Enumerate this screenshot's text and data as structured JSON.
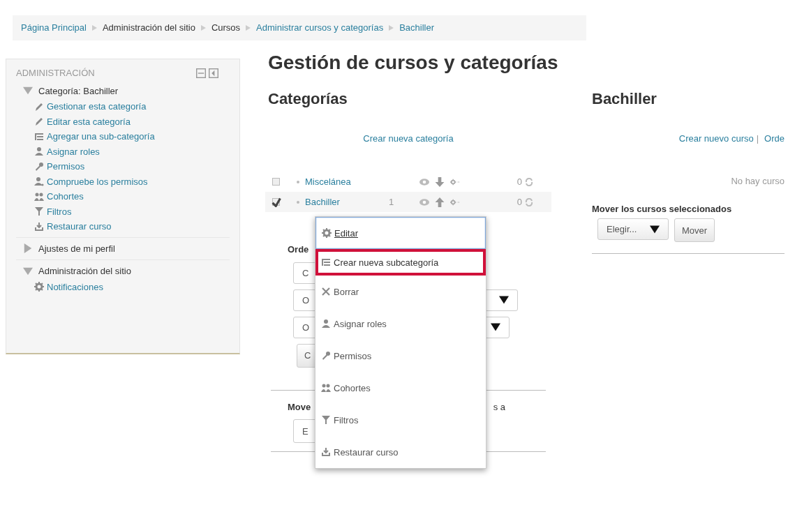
{
  "breadcrumb": [
    {
      "label": "Página Principal",
      "kind": "link"
    },
    {
      "label": "Administración del sitio",
      "kind": "text"
    },
    {
      "label": "Cursos",
      "kind": "text"
    },
    {
      "label": "Administrar cursos y categorías",
      "kind": "link"
    },
    {
      "label": "Bachiller",
      "kind": "link"
    }
  ],
  "sidebar": {
    "title": "ADMINISTRACIÓN",
    "nodes": [
      {
        "label": "Categoría: Bachiller",
        "expanded": true,
        "children": [
          {
            "label": "Gestionar esta categoría"
          },
          {
            "label": "Editar esta categoría"
          },
          {
            "label": "Agregar una sub-categoría"
          },
          {
            "label": "Asignar roles"
          },
          {
            "label": "Permisos"
          },
          {
            "label": "Compruebe los permisos"
          },
          {
            "label": "Cohortes"
          },
          {
            "label": "Filtros"
          },
          {
            "label": "Restaurar curso"
          }
        ]
      },
      {
        "label": "Ajustes de mi perfil",
        "expanded": false
      },
      {
        "label": "Administración del sitio",
        "expanded": true,
        "children": [
          {
            "label": "Notificaciones"
          }
        ]
      }
    ]
  },
  "page_title": "Gestión de cursos y categorías",
  "categories": {
    "title": "Categorías",
    "create_link": "Crear nueva categoría",
    "rows": [
      {
        "name": "Miscelánea",
        "checked": false,
        "courses": "0"
      },
      {
        "name": "Bachiller",
        "checked": true,
        "subcategories": "1",
        "courses": "0"
      }
    ],
    "sort_form": {
      "label": "Orde",
      "fields": [
        {
          "kind": "select",
          "value": "C"
        },
        {
          "kind": "select",
          "value": "O",
          "caret": true
        },
        {
          "kind": "select",
          "value": "O",
          "caret": true
        },
        {
          "kind": "button",
          "value": "C"
        }
      ]
    },
    "move_form": {
      "label": "Move",
      "label_end": "s a",
      "select": "E"
    }
  },
  "context_menu": {
    "items": [
      {
        "label": "Editar",
        "focused": true,
        "highlighted": false
      },
      {
        "label": "Crear nueva subcategoría",
        "focused": false,
        "highlighted": true
      },
      {
        "label": "Borrar",
        "focused": false,
        "highlighted": false
      },
      {
        "label": "Asignar roles",
        "focused": false,
        "highlighted": false
      },
      {
        "label": "Permisos",
        "focused": false,
        "highlighted": false
      },
      {
        "label": "Cohortes",
        "focused": false,
        "highlighted": false
      },
      {
        "label": "Filtros",
        "focused": false,
        "highlighted": false
      },
      {
        "label": "Restaurar curso",
        "focused": false,
        "highlighted": false
      }
    ]
  },
  "course_panel": {
    "title": "Bachiller",
    "links": [
      {
        "label": "Crear nuevo curso"
      },
      {
        "label": "Orde"
      }
    ],
    "separator": "|",
    "empty_message": "No hay curso",
    "move_label": "Mover los cursos seleccionados",
    "select": "Elegir...",
    "button": "Mover"
  }
}
